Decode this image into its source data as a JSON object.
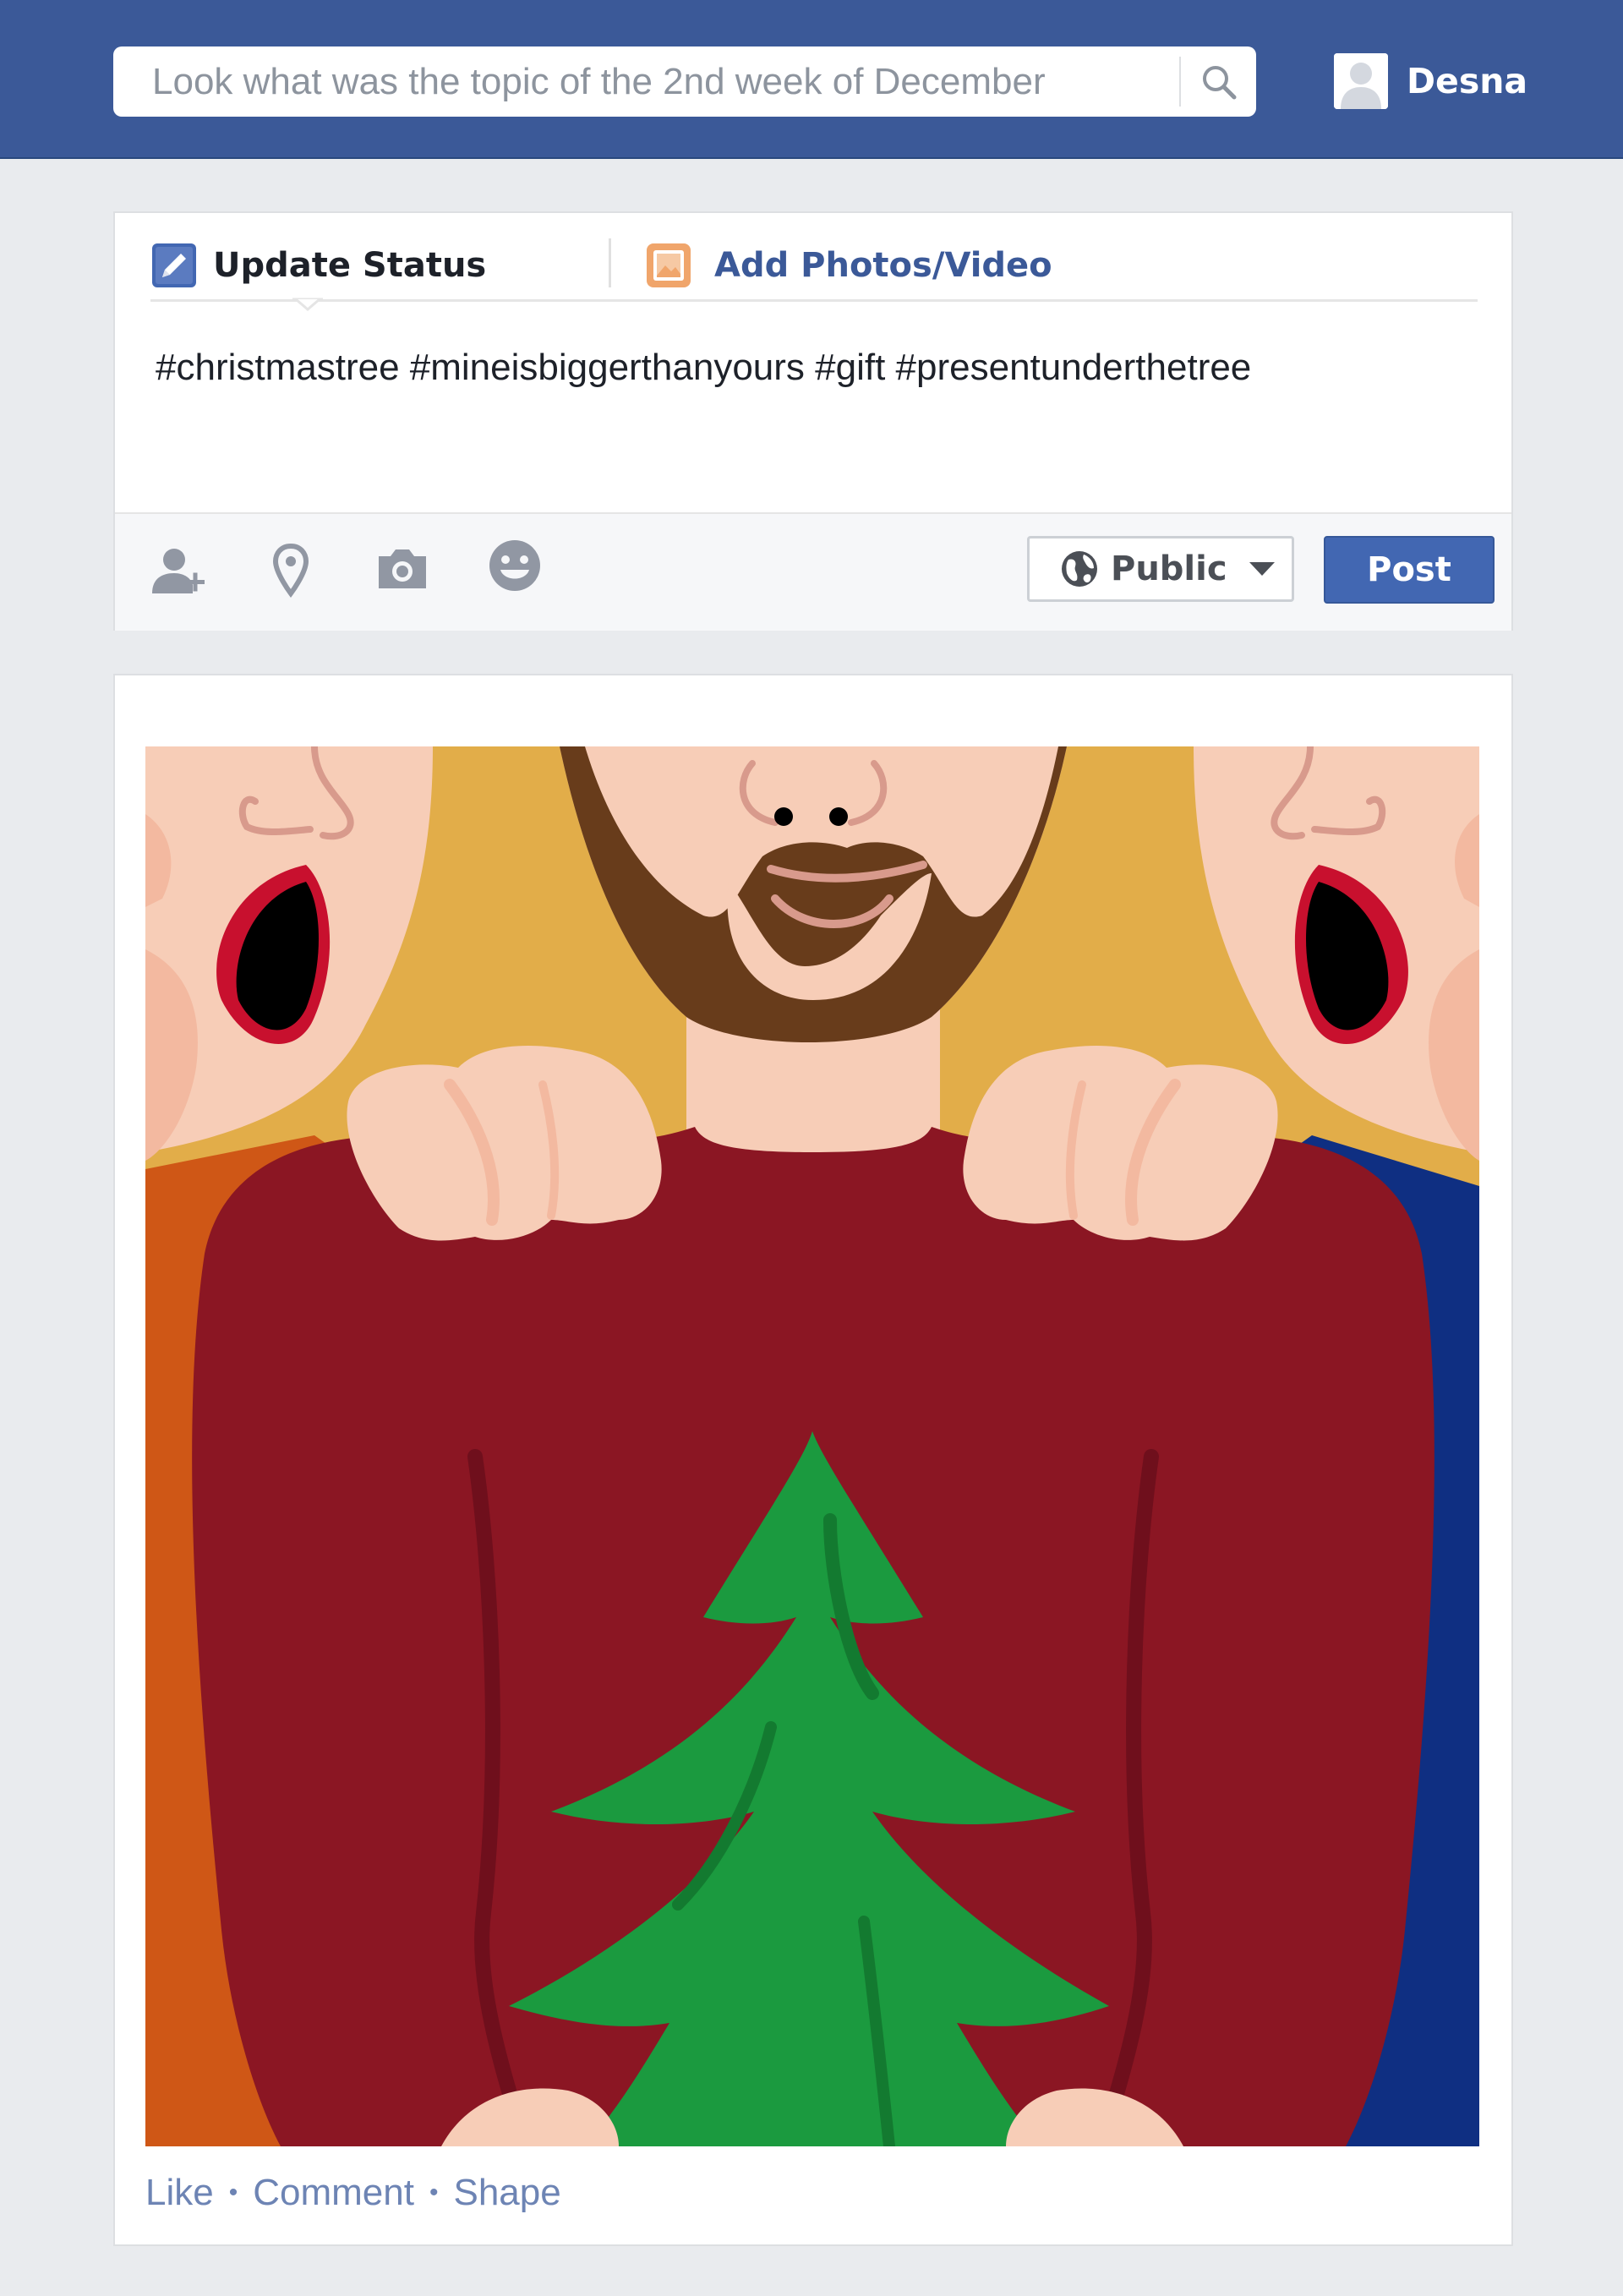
{
  "header": {
    "search_placeholder": "Look what was the topic of the 2nd week of December",
    "user_name": "Desna"
  },
  "composer": {
    "tab_update": "Update Status",
    "tab_photos": "Add Photos/Video",
    "status_text": "#christmastree #mineisbiggerthanyours #gift #presentunderthetree",
    "audience_label": "Public",
    "post_label": "Post"
  },
  "post": {
    "actions": [
      "Like",
      "Comment",
      "Shape"
    ]
  },
  "colors": {
    "brand": "#3b5998",
    "link": "#4267b2",
    "sweater": "#8b1623",
    "tree": "#1b9a3f",
    "background_yellow": "#e2ad49",
    "left_shirt": "#cf5716",
    "right_shirt": "#0f2f82"
  }
}
